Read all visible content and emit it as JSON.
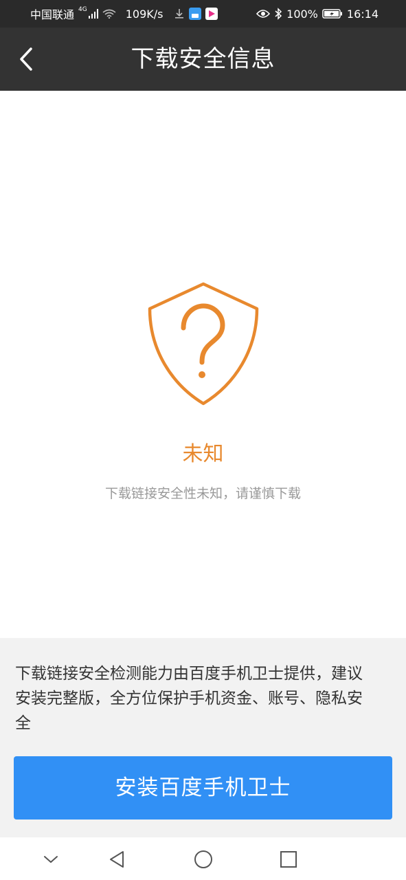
{
  "status_bar": {
    "carrier": "中国联通",
    "network_type": "4G",
    "speed": "109K/s",
    "battery": "100%",
    "time": "16:14",
    "icons": [
      "signal-icon",
      "wifi-icon",
      "download-icon",
      "app-notification-icon",
      "video-app-icon",
      "eye-icon",
      "bluetooth-icon",
      "battery-icon"
    ]
  },
  "header": {
    "title": "下载安全信息",
    "back_icon": "chevron-left-icon"
  },
  "result": {
    "icon": "shield-question-icon",
    "label": "未知",
    "description": "下载链接安全性未知，请谨慎下载"
  },
  "footer": {
    "info": "下载链接安全检测能力由百度手机卫士提供，建议安装完整版，全方位保护手机资金、账号、隐私安全",
    "install_button": "安装百度手机卫士"
  },
  "nav": {
    "icons": [
      "chevron-down-icon",
      "back-triangle-icon",
      "home-circle-icon",
      "recents-square-icon"
    ]
  },
  "colors": {
    "status_bar_bg": "#2a2a2a",
    "title_bar_bg": "#333333",
    "accent_orange": "#e8892e",
    "button_blue": "#3190f5",
    "panel_bg": "#f2f2f2",
    "secondary_text": "#999999"
  }
}
